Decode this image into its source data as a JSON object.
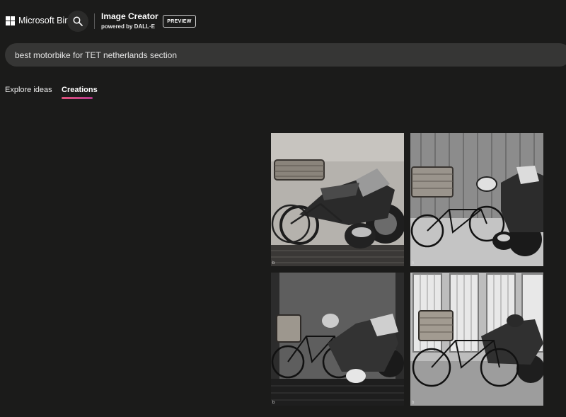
{
  "header": {
    "brand": "Microsoft Bing",
    "app_title": "Image Creator",
    "app_subtitle": "powered by DALL·E",
    "preview_label": "PREVIEW"
  },
  "prompt": {
    "value": "best motorbike for TET netherlands section"
  },
  "tabs": [
    {
      "label": "Explore ideas",
      "active": false
    },
    {
      "label": "Creations",
      "active": true
    }
  ],
  "images": [
    {
      "corner_mark": "b"
    },
    {
      "corner_mark": "b"
    },
    {
      "corner_mark": "b"
    },
    {
      "corner_mark": "b"
    }
  ],
  "colors": {
    "background": "#1b1b1a",
    "prompt_bar": "#363635",
    "tab_accent": "#e0537b"
  }
}
